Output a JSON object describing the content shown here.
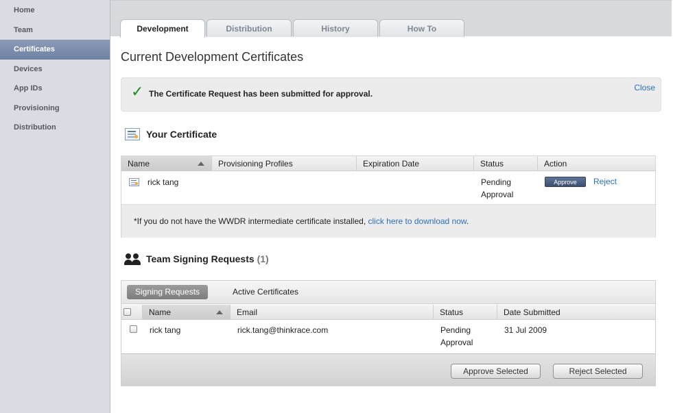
{
  "sidebar": {
    "items": [
      {
        "label": "Home"
      },
      {
        "label": "Team"
      },
      {
        "label": "Certificates"
      },
      {
        "label": "Devices"
      },
      {
        "label": "App IDs"
      },
      {
        "label": "Provisioning"
      },
      {
        "label": "Distribution"
      }
    ],
    "active_item": "Certificates"
  },
  "tabs": [
    {
      "label": "Development"
    },
    {
      "label": "Distribution"
    },
    {
      "label": "History"
    },
    {
      "label": "How To"
    }
  ],
  "page": {
    "title": "Current Development Certificates"
  },
  "notice": {
    "icon": "checkmark-icon",
    "message": "The Certificate Request has been submitted for approval.",
    "close_label": "Close"
  },
  "your_certificate": {
    "heading": "Your Certificate",
    "icon": "certificate-icon",
    "columns": [
      "Name",
      "Provisioning Profiles",
      "Expiration Date",
      "Status",
      "Action"
    ],
    "rows": [
      {
        "name": "rick tang",
        "provisioning_profiles": "",
        "expiration_date": "",
        "status_line1": "Pending",
        "status_line2": "Approval",
        "approve_label": "Approve",
        "reject_label": "Reject"
      }
    ],
    "footnote_prefix": "*If you do not have the WWDR intermediate certificate installed, ",
    "footnote_link": "click here to download now",
    "footnote_suffix": "."
  },
  "team_signing": {
    "heading": "Team Signing Requests",
    "count": "(1)",
    "icon": "people-icon",
    "segments": [
      {
        "label": "Signing Requests"
      },
      {
        "label": "Active Certificates"
      }
    ],
    "columns": [
      "Name",
      "Email",
      "Status",
      "Date Submitted"
    ],
    "rows": [
      {
        "name": "rick tang",
        "email": "rick.tang@thinkrace.com",
        "status_line1": "Pending",
        "status_line2": "Approval",
        "date_submitted": "31 Jul 2009"
      }
    ],
    "approve_selected_label": "Approve Selected",
    "reject_selected_label": "Reject Selected"
  },
  "colors": {
    "accent_link": "#2a6fb6",
    "sidebar_active": "#7a8bab",
    "success_check": "#1f8a1f"
  }
}
